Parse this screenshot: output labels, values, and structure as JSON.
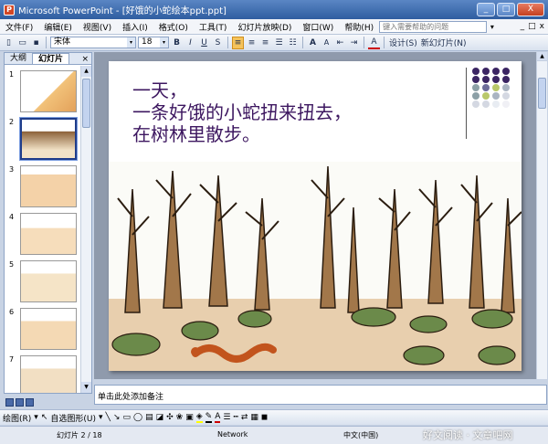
{
  "window": {
    "title": "Microsoft PowerPoint - [好饿的小蛇绘本ppt.ppt]",
    "app_icon": "P"
  },
  "window_buttons": {
    "minimize": "_",
    "maximize": "□",
    "close": "X"
  },
  "menu": {
    "items": [
      "文件(F)",
      "编辑(E)",
      "视图(V)",
      "插入(I)",
      "格式(O)",
      "工具(T)",
      "幻灯片放映(D)",
      "窗口(W)",
      "帮助(H)"
    ],
    "help_placeholder": "键入需要帮助的问题",
    "help_arrow": "▾",
    "doc_controls": [
      "_",
      "□",
      "x"
    ]
  },
  "toolbar": {
    "font": "宋体",
    "font_size": "18",
    "bold": "B",
    "italic": "I",
    "underline": "U",
    "shadow": "S",
    "grow_font": "A",
    "shrink_font": "A",
    "font_color": "A",
    "design": "设计(S)",
    "new_slide": "新幻灯片(N)",
    "combo_arrow": "▾"
  },
  "left_pane": {
    "tabs": [
      "大纲",
      "幻灯片"
    ],
    "close": "×",
    "slide_numbers": [
      "1",
      "2",
      "3",
      "4",
      "5",
      "6",
      "7"
    ],
    "selected_index": 1,
    "scroll_up": "▲",
    "scroll_down": "▼"
  },
  "slide": {
    "line1": "一天，",
    "line2": "一条好饿的小蛇扭来扭去，",
    "line3": "在树林里散步。",
    "accent_color": "#3d1760",
    "dot_colors": [
      "#3b2563",
      "#3b2563",
      "#3b2563",
      "#3b2563",
      "#3b2563",
      "#3b2563",
      "#3b2563",
      "#3b2563",
      "#8ca0a6",
      "#6d6c9a",
      "#b9c86a",
      "#aab4c2",
      "#8ca0a6",
      "#b9c86a",
      "#aab4c2",
      "#d4d8e2",
      "#d4d8e2",
      "#d4d8e2",
      "#e8ecf2",
      "#f0f0f5"
    ]
  },
  "notes": {
    "placeholder": "单击此处添加备注"
  },
  "drawing_toolbar": {
    "draw": "绘图(R)",
    "autoshapes": "自选图形(U)",
    "arrow": "▾"
  },
  "status": {
    "slide": "幻灯片 2 / 18",
    "design": "Network",
    "language": "中文(中国)"
  },
  "watermark": "好文阅读 · 文章吧网"
}
